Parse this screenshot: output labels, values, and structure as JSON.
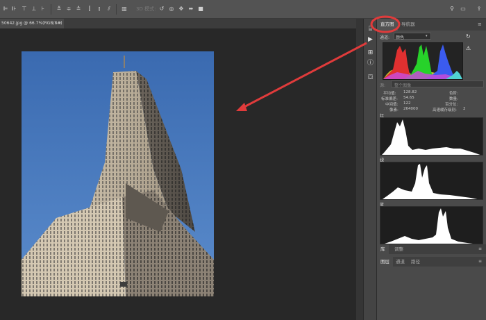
{
  "toolbar": {
    "mode_3d": "3D 模式:"
  },
  "document": {
    "tab_label": "50642.jpg @ 66.7%(RGB/8#)",
    "close_glyph": "×"
  },
  "panel": {
    "tabs": [
      {
        "label": "直方图",
        "active": true
      },
      {
        "label": "导航器",
        "active": false
      }
    ],
    "channel_label": "通道:",
    "channel_value": "颜色",
    "source_label": "源:",
    "source_value": "整个图像",
    "stats": {
      "mean_label": "平均值:",
      "mean_value": "128.82",
      "stddev_label": "标准偏差:",
      "stddev_value": "54.65",
      "median_label": "中间值:",
      "median_value": "122",
      "pixels_label": "像素:",
      "pixels_value": "264000",
      "level_label": "色阶:",
      "count_label": "数量:",
      "percentile_label": "百分位:",
      "cache_label": "高速缓存级别:",
      "cache_value": "2"
    },
    "channels": [
      {
        "label": "红"
      },
      {
        "label": "绿"
      },
      {
        "label": "蓝"
      }
    ],
    "lower_tabs_1": [
      {
        "label": "库",
        "active": true
      },
      {
        "label": "调整",
        "active": false
      }
    ],
    "lower_tabs_2": [
      {
        "label": "图层",
        "active": true
      },
      {
        "label": "通道",
        "active": false
      },
      {
        "label": "路径",
        "active": false
      }
    ]
  },
  "colors": {
    "highlight_circle": "#e03b3b",
    "arrow": "#e03b3b",
    "sky": "#3e6fb4"
  }
}
